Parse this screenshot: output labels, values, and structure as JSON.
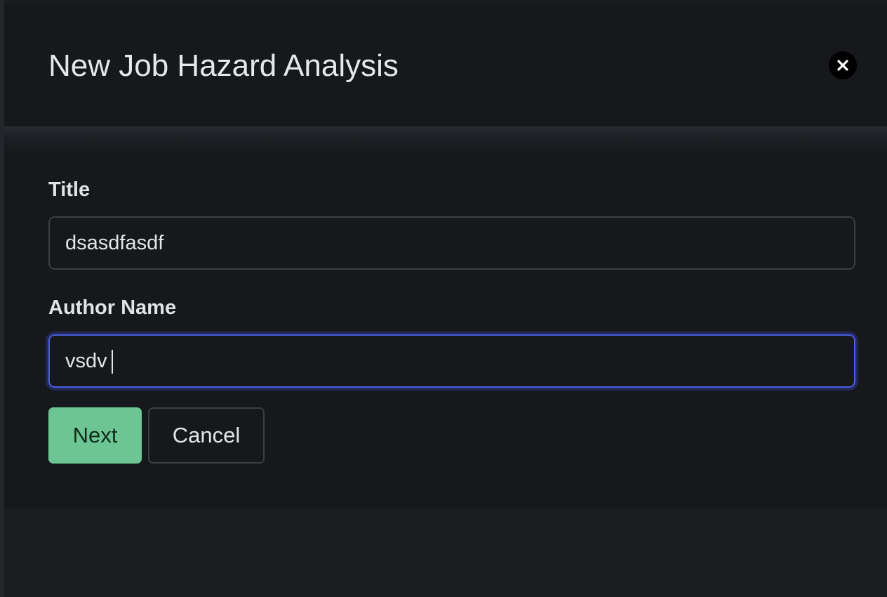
{
  "modal": {
    "title": "New Job Hazard Analysis",
    "close_icon": "close-icon"
  },
  "form": {
    "title_field": {
      "label": "Title",
      "value": "dsasdfasdf"
    },
    "author_field": {
      "label": "Author Name",
      "value": "vsdv",
      "focused": true
    }
  },
  "actions": {
    "next_label": "Next",
    "cancel_label": "Cancel"
  },
  "colors": {
    "primary_button": "#6cc593",
    "focus_ring": "#4a5ee0",
    "modal_background": "#16181c"
  }
}
